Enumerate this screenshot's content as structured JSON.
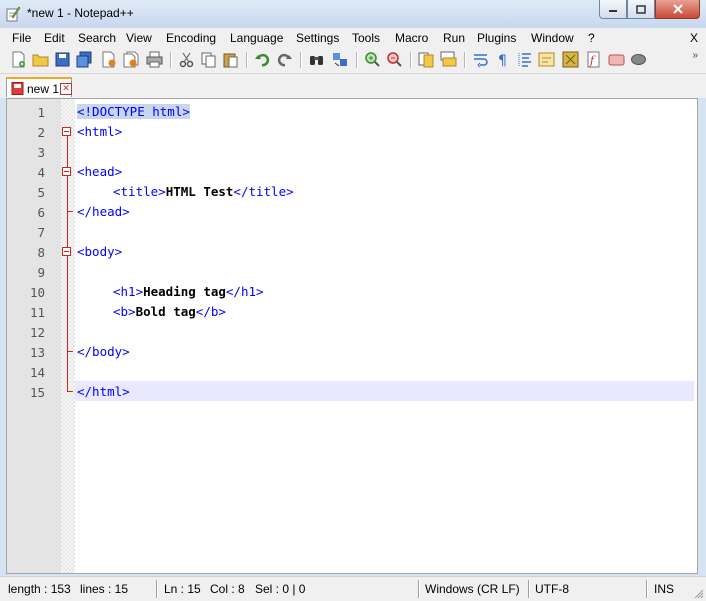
{
  "window": {
    "title": "*new 1 - Notepad++"
  },
  "menu": {
    "items": [
      "File",
      "Edit",
      "Search",
      "View",
      "Encoding",
      "Language",
      "Settings",
      "Tools",
      "Macro",
      "Run",
      "Plugins",
      "Window",
      "?"
    ],
    "close_label": "X"
  },
  "toolbar": {
    "more_label": "»",
    "icons": [
      "new-file-icon",
      "open-file-icon",
      "save-icon",
      "save-all-icon",
      "close-icon",
      "close-all-icon",
      "print-icon",
      "cut-icon",
      "copy-icon",
      "paste-icon",
      "undo-icon",
      "redo-icon",
      "find-icon",
      "replace-icon",
      "zoom-in-icon",
      "zoom-out-icon",
      "sync-vertical-icon",
      "sync-horizontal-icon",
      "word-wrap-icon",
      "show-all-chars-icon",
      "indent-guide-icon",
      "user-lang-icon",
      "doc-map-icon",
      "function-list-icon",
      "record-macro-icon",
      "stop-macro-icon"
    ]
  },
  "tabs": [
    {
      "label": "new 1",
      "modified": true
    }
  ],
  "editor": {
    "lines": [
      "1",
      "2",
      "3",
      "4",
      "5",
      "6",
      "7",
      "8",
      "9",
      "10",
      "11",
      "12",
      "13",
      "14",
      "15"
    ],
    "code": {
      "l1_doctype": "<!DOCTYPE html>",
      "l2_open": "<html>",
      "l4_open": "<head>",
      "l5_open": "<title>",
      "l5_text": "HTML Test",
      "l5_close": "</title>",
      "l6_close": "</head>",
      "l8_open": "<body>",
      "l10_open": "<h1>",
      "l10_text": "Heading tag",
      "l10_close": "</h1>",
      "l11_open": "<b>",
      "l11_text": "Bold tag",
      "l11_close": "</b>",
      "l13_close": "</body>",
      "l15_close": "</html>"
    }
  },
  "status": {
    "length": "length : 153",
    "lines": "lines : 15",
    "ln": "Ln : 15",
    "col": "Col : 8",
    "sel": "Sel : 0 | 0",
    "eol": "Windows (CR LF)",
    "encoding": "UTF-8",
    "mode": "INS"
  },
  "colors": {
    "tag": "#0000ff",
    "fold": "#d12525",
    "current_line": "#e8e8ff",
    "tab_accent": "#f5a623"
  }
}
